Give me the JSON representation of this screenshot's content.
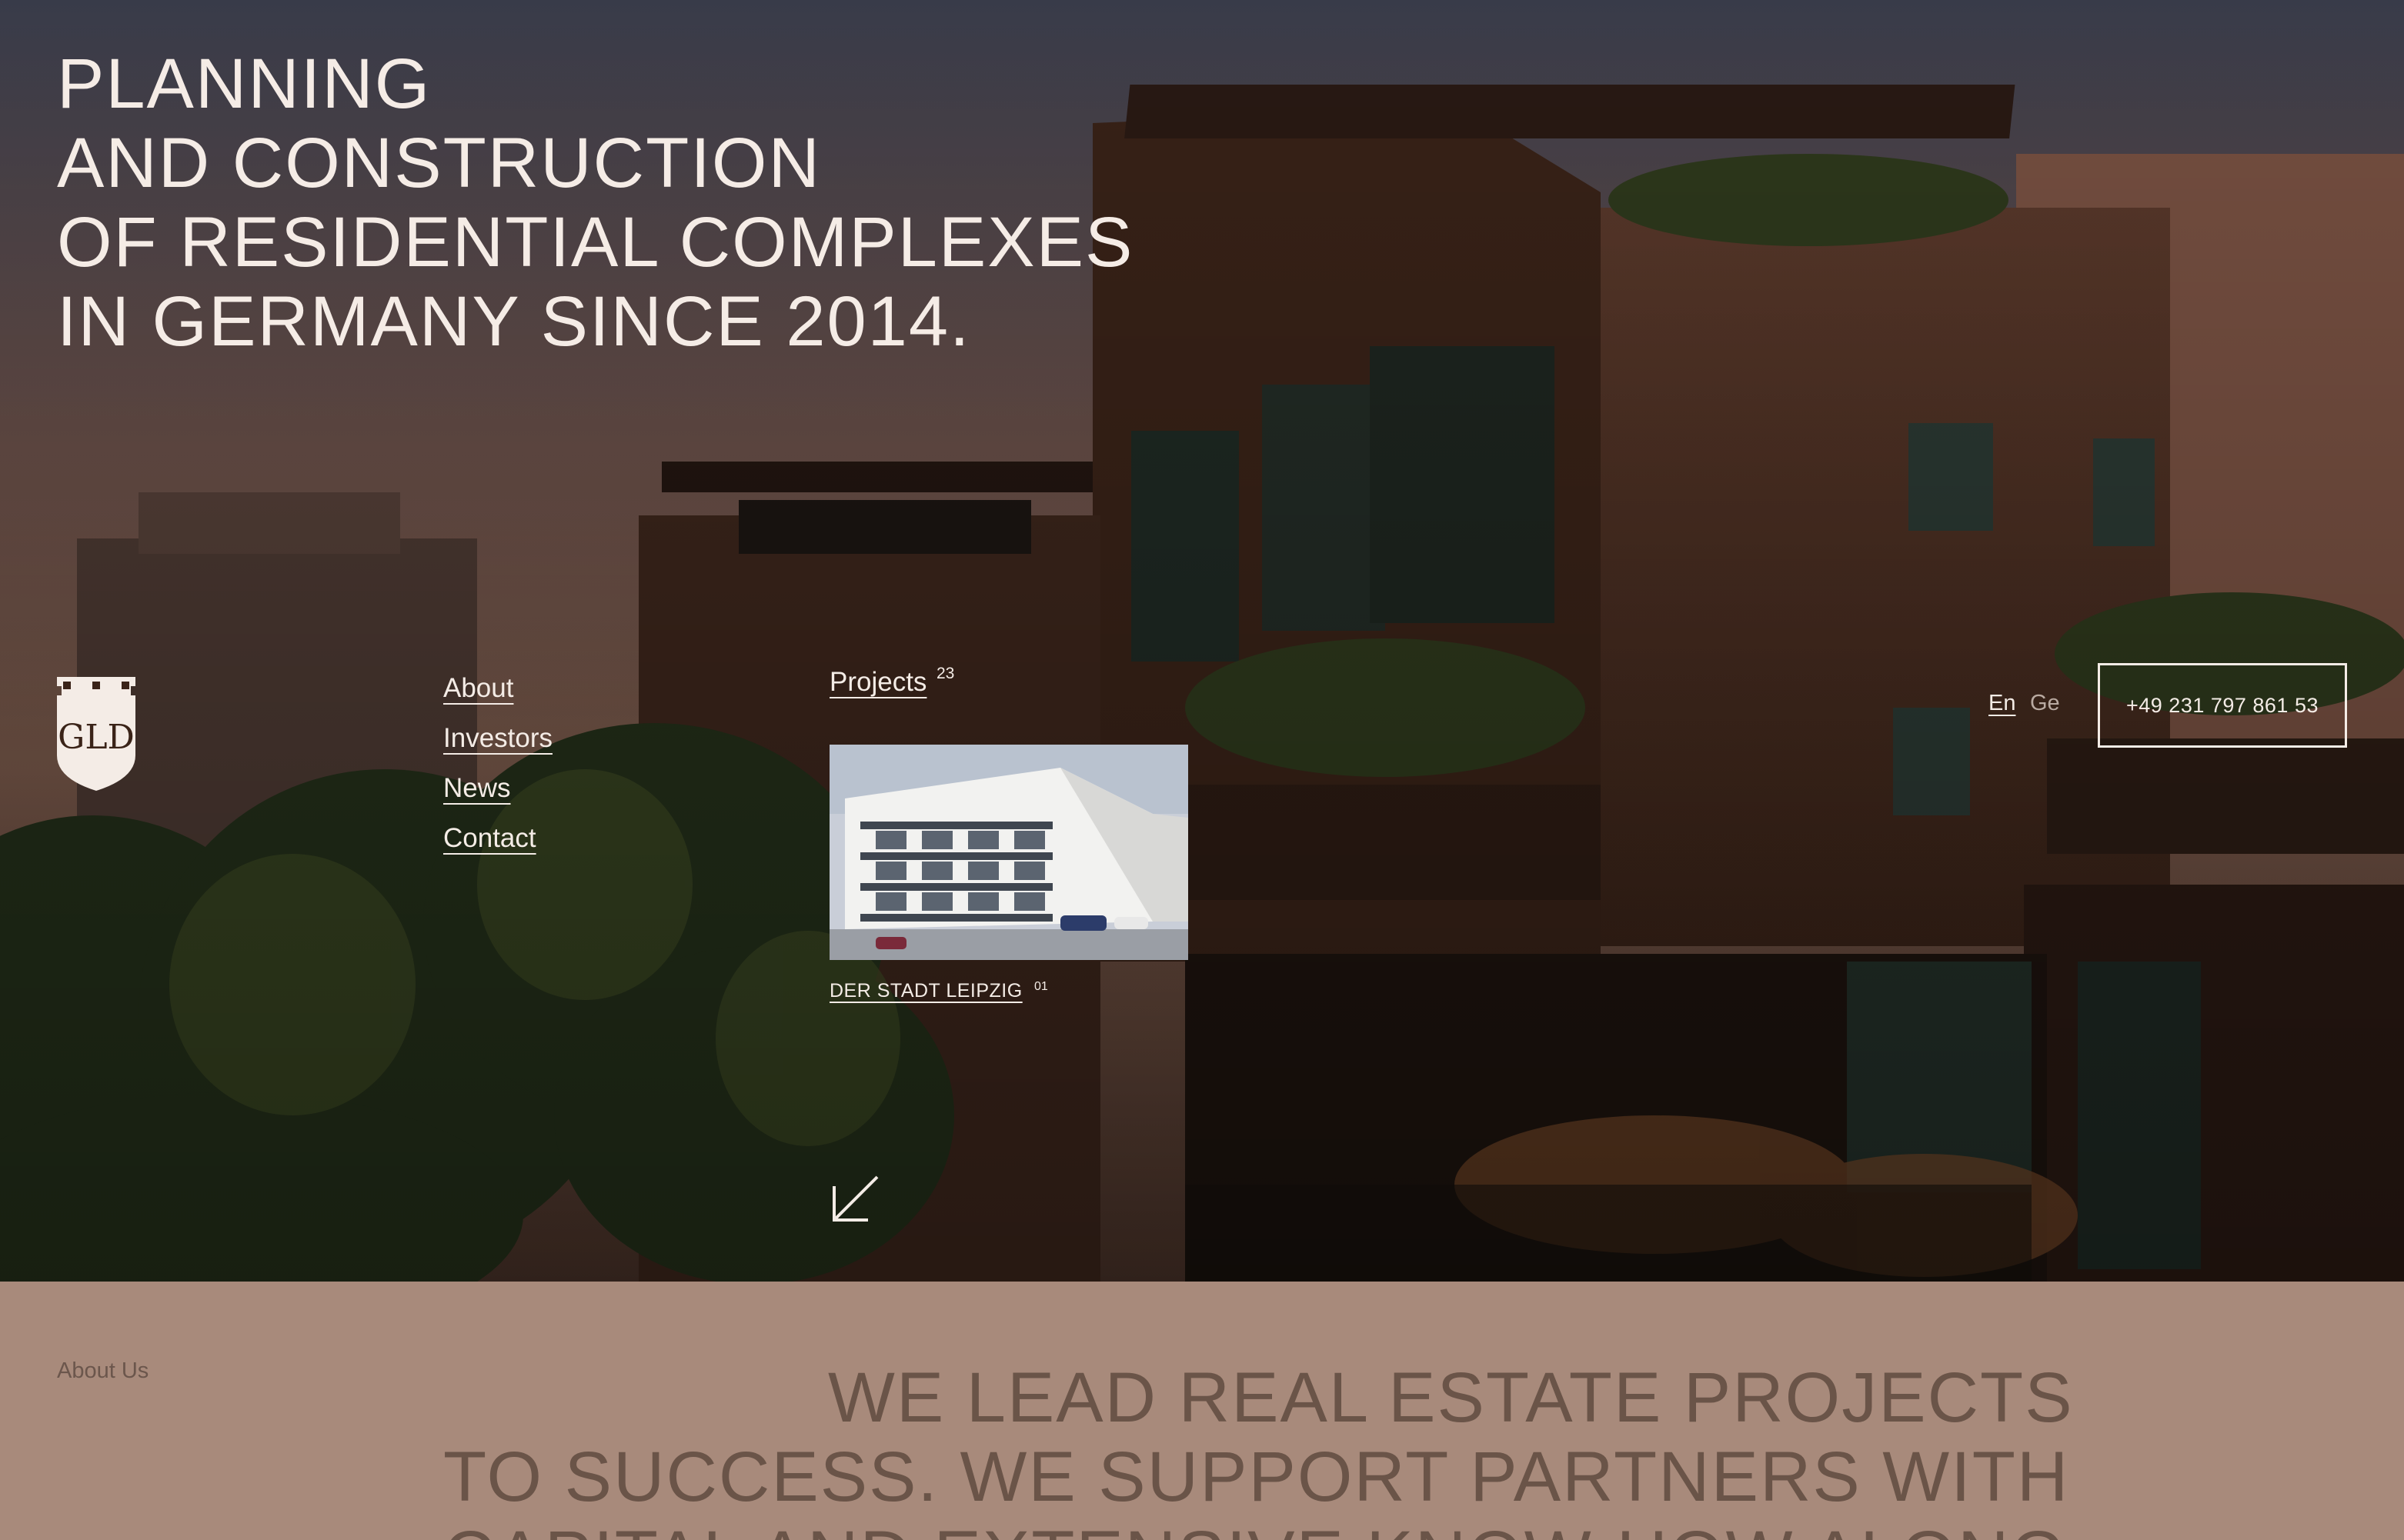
{
  "hero": {
    "headline": [
      "PLANNING",
      "AND CONSTRUCTION",
      "OF RESIDENTIAL COMPLEXES",
      "IN GERMANY SINCE 2014."
    ],
    "logo": {
      "icon": "gld-shield-logo",
      "text": "GLD"
    }
  },
  "nav": {
    "items": [
      {
        "label": "About"
      },
      {
        "label": "Investors"
      },
      {
        "label": "News"
      },
      {
        "label": "Contact"
      }
    ],
    "projects": {
      "label": "Projects",
      "count": "23"
    }
  },
  "featured_project": {
    "name": "DER STADT LEIPZIG",
    "number": "01",
    "icon": "arrow-down-left-icon"
  },
  "language": {
    "en": "En",
    "ge": "Ge",
    "active": "En"
  },
  "phone": "+49 231 797 861 53",
  "about": {
    "label": "About Us",
    "text": [
      "WE LEAD REAL ESTATE PROJECTS",
      "TO SUCCESS. WE SUPPORT PARTNERS WITH",
      "CAPITAL AND EXTENSIVE KNOW-HOW ALONG"
    ]
  },
  "colors": {
    "text_light": "#f4ece6",
    "about_bg": "#a88a7b",
    "about_text": "#6a5448"
  }
}
